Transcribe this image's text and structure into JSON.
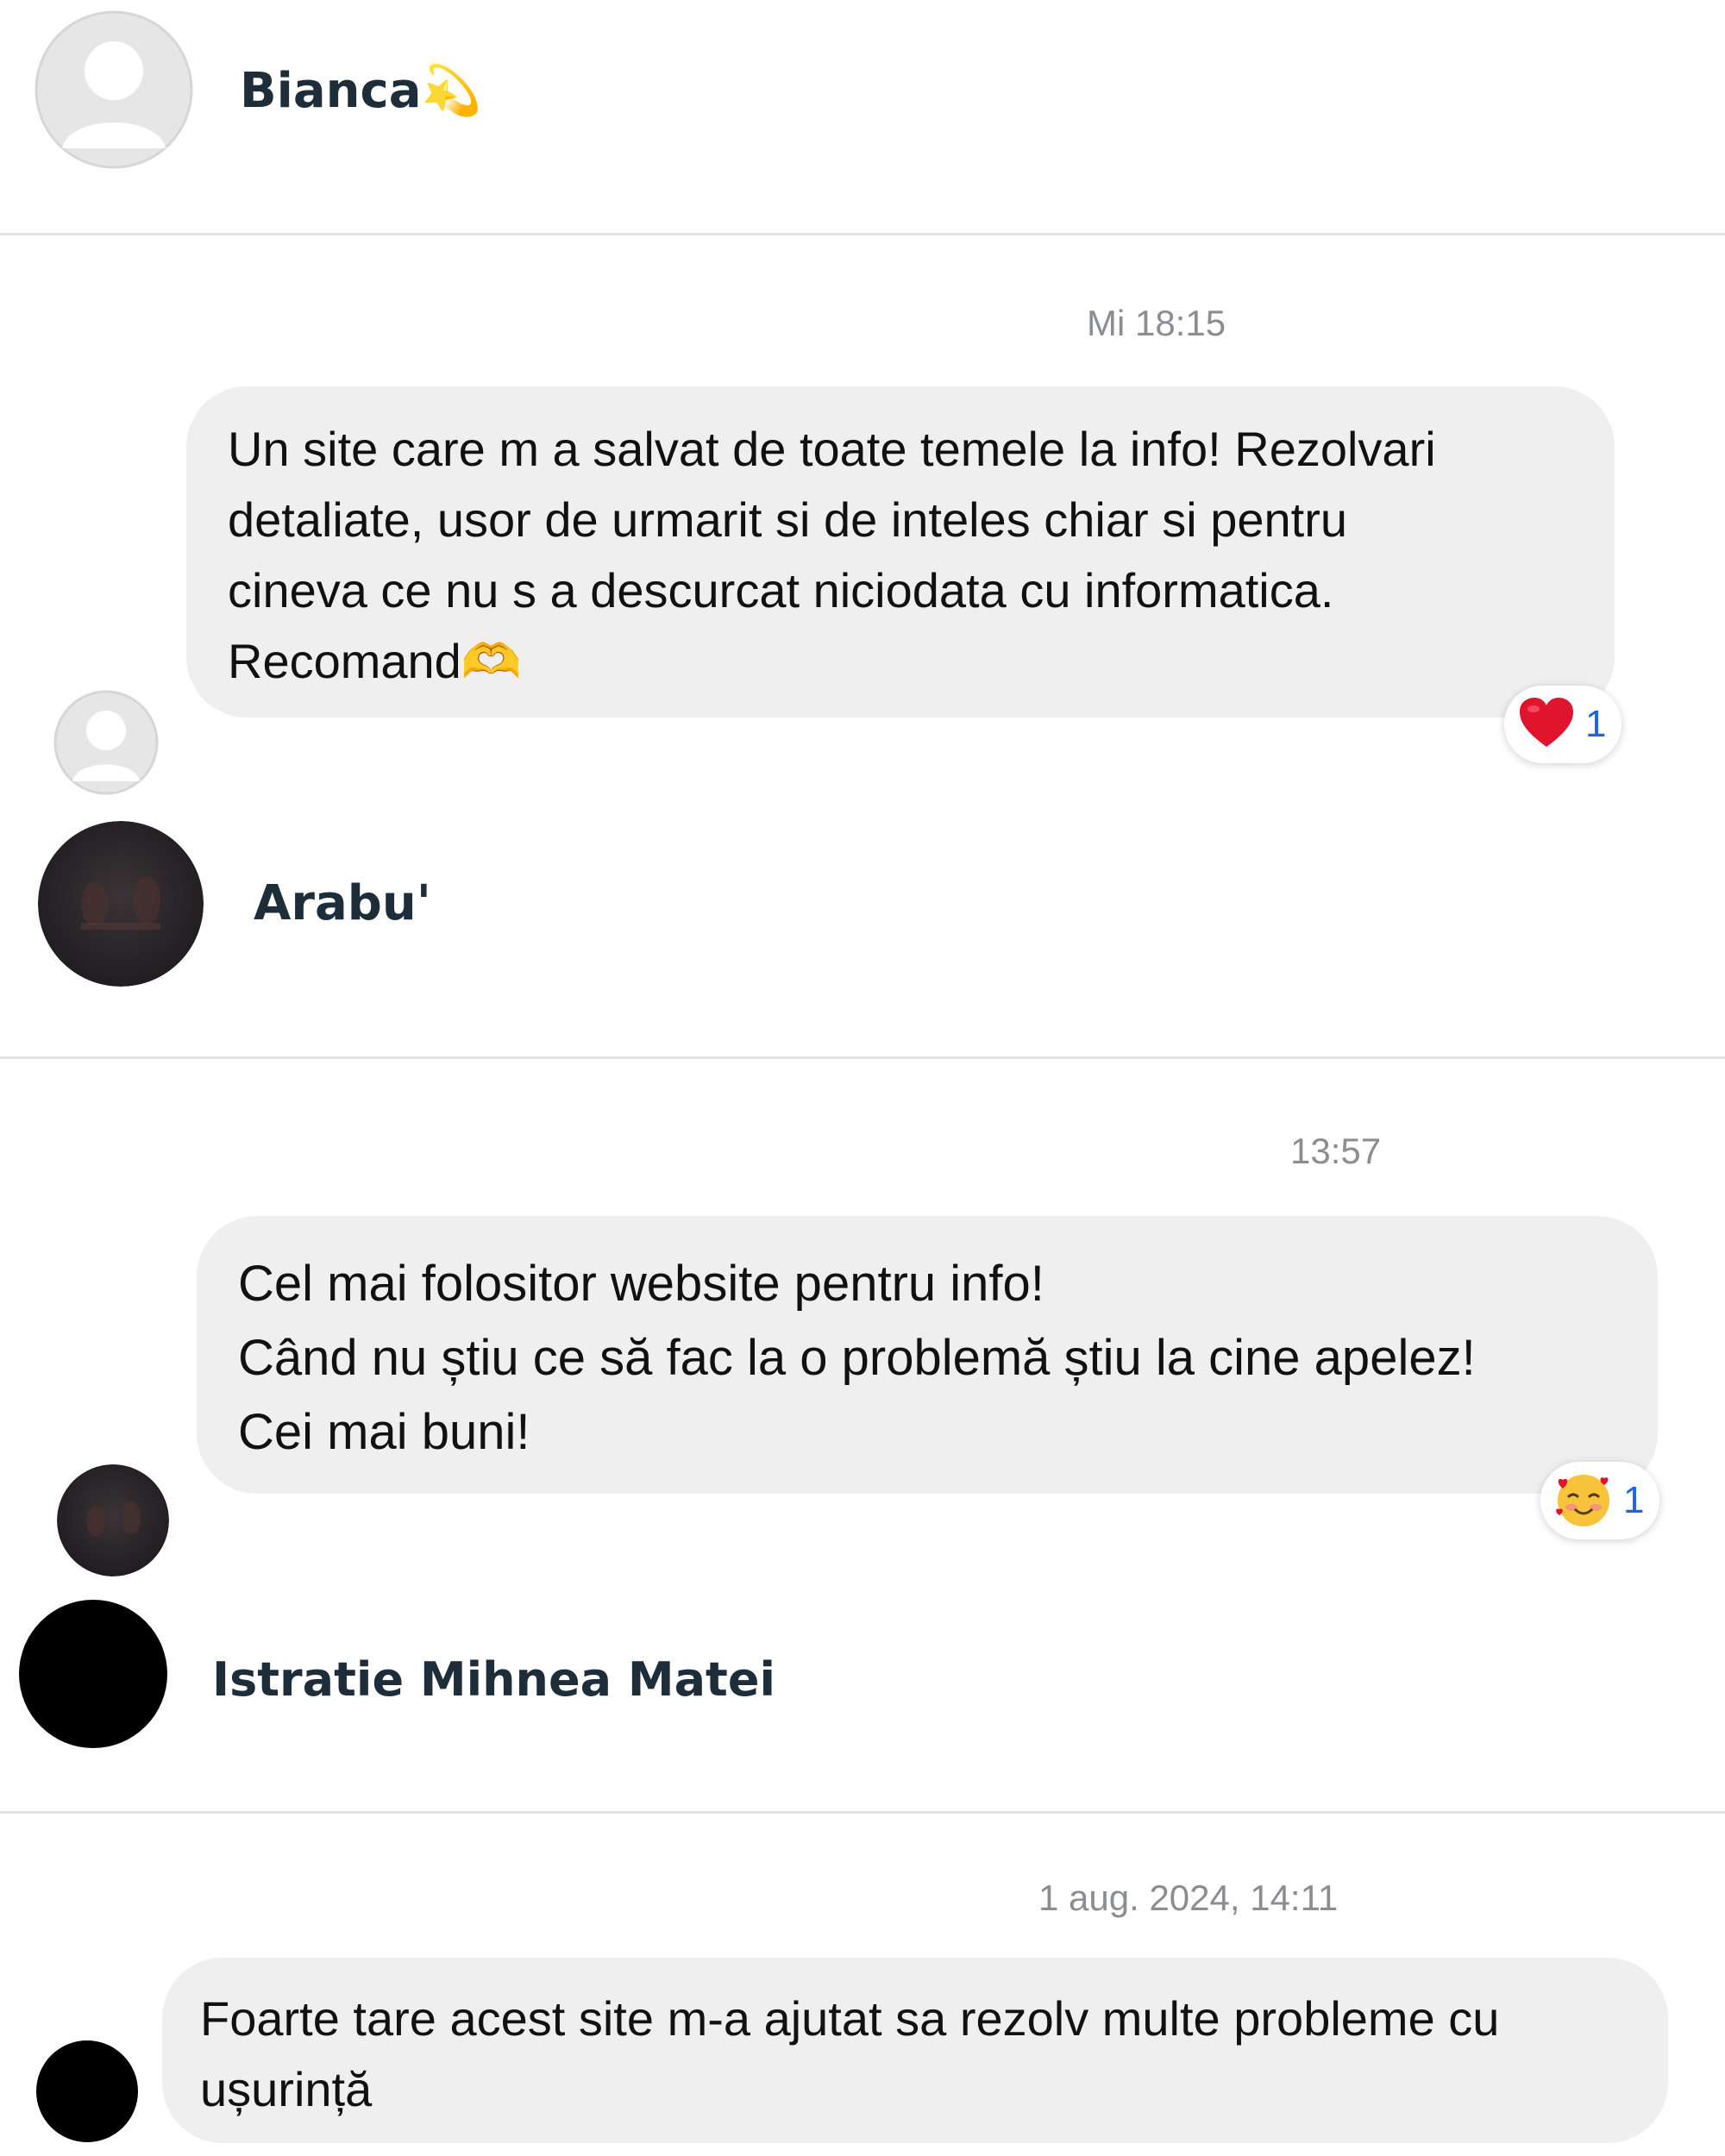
{
  "conversations": [
    {
      "author": "Bianca💫",
      "timestamp": "Mi 18:15",
      "message_lines": [
        "Un site care m a salvat de toate temele la info! Rezolvari",
        "detaliate, usor de urmarit si de inteles chiar si pentru",
        "cineva ce nu s a descurcat niciodata cu informatica.",
        "Recomand🫶"
      ],
      "reaction": {
        "icon": "heart-icon",
        "emoji": "❤️",
        "count": "1"
      }
    },
    {
      "author": "Arabu'",
      "timestamp": "13:57",
      "message_lines": [
        "Cel mai folositor website pentru info!",
        "Când nu știu ce să fac la o problemă știu la cine apelez!",
        "Cei mai buni!"
      ],
      "reaction": {
        "icon": "smiling-face-with-hearts-icon",
        "emoji": "🥰",
        "count": "1"
      }
    },
    {
      "author": "Istratie Mihnea Matei",
      "timestamp": "1 aug. 2024, 14:11",
      "message_lines": [
        "Foarte tare acest site m-a ajutat sa rezolv multe probleme cu",
        "ușurință"
      ]
    }
  ],
  "colors": {
    "bubble": "#efefef",
    "name": "#1e2d3a",
    "timestamp": "#8a8d91",
    "reaction_count": "#1a66e0",
    "divider": "#e2e2e2"
  }
}
